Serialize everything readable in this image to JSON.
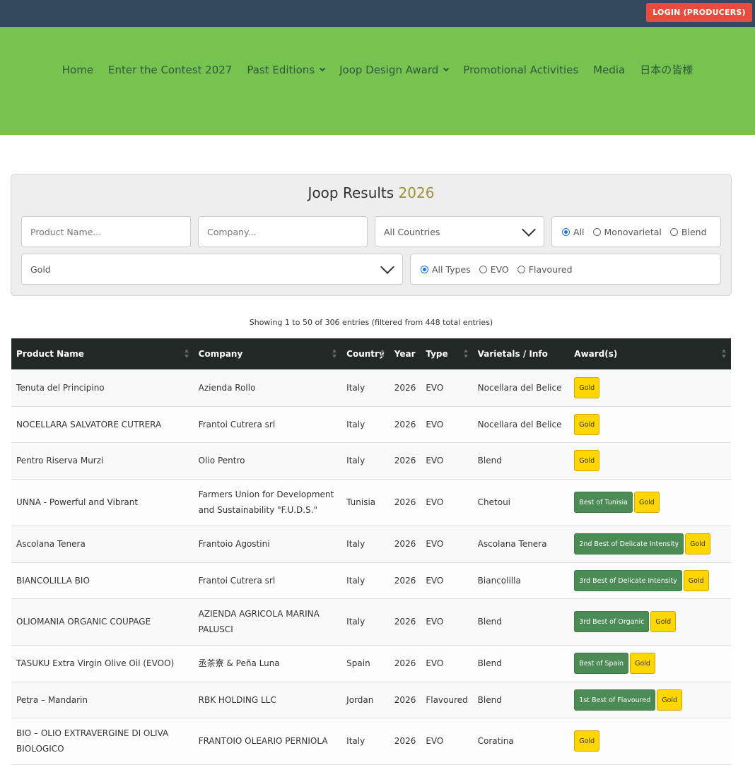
{
  "header": {
    "login_label": "LOGIN (PRODUCERS)"
  },
  "nav": {
    "items": [
      {
        "label": "Home",
        "dropdown": false
      },
      {
        "label": "Enter the Contest 2027",
        "dropdown": false
      },
      {
        "label": "Past Editions",
        "dropdown": true
      },
      {
        "label": "Joop Design Award",
        "dropdown": true
      },
      {
        "label": "Promotional Activities",
        "dropdown": false
      },
      {
        "label": "Media",
        "dropdown": false
      },
      {
        "label": "日本の皆様",
        "dropdown": false
      }
    ]
  },
  "filters": {
    "title": "Joop Results",
    "title_year": "2026",
    "product_placeholder": "Product Name...",
    "company_placeholder": "Company...",
    "country_selected": "All Countries",
    "award_selected": "Gold",
    "varietal_options": [
      "All",
      "Monovarietal",
      "Blend"
    ],
    "varietal_selected": 0,
    "type_options": [
      "All Types",
      "EVO",
      "Flavoured"
    ],
    "type_selected": 0
  },
  "table": {
    "info": "Showing 1 to 50 of 306 entries (filtered from 448 total entries)",
    "columns": [
      "Product Name",
      "Company",
      "Country",
      "Year",
      "Type",
      "Varietals / Info",
      "Award(s)"
    ],
    "rows": [
      {
        "product": "Tenuta del Principino",
        "company": "Azienda Rollo",
        "country": "Italy",
        "year": "2026",
        "type": "EVO",
        "varietal": "Nocellara del Belice",
        "awards": [
          {
            "label": "Gold",
            "kind": "gold"
          }
        ]
      },
      {
        "product": "NOCELLARA SALVATORE CUTRERA",
        "company": "Frantoi Cutrera srl",
        "country": "Italy",
        "year": "2026",
        "type": "EVO",
        "varietal": "Nocellara del Belice",
        "awards": [
          {
            "label": "Gold",
            "kind": "gold"
          }
        ]
      },
      {
        "product": "Pentro Riserva Murzi",
        "company": "Olio Pentro",
        "country": "Italy",
        "year": "2026",
        "type": "EVO",
        "varietal": "Blend",
        "awards": [
          {
            "label": "Gold",
            "kind": "gold"
          }
        ]
      },
      {
        "product": "UNNA - Powerful and Vibrant",
        "company": "Farmers Union for Development and Sustainability \"F.U.D.S.\"",
        "country": "Tunisia",
        "year": "2026",
        "type": "EVO",
        "varietal": "Chetoui",
        "awards": [
          {
            "label": "Best of Tunisia",
            "kind": "green"
          },
          {
            "label": "Gold",
            "kind": "gold"
          }
        ]
      },
      {
        "product": "Ascolana Tenera",
        "company": "Frantoio Agostini",
        "country": "Italy",
        "year": "2026",
        "type": "EVO",
        "varietal": "Ascolana Tenera",
        "awards": [
          {
            "label": "2nd Best of Delicate Intensity",
            "kind": "green"
          },
          {
            "label": "Gold",
            "kind": "gold"
          }
        ]
      },
      {
        "product": "BIANCOLILLA BIO",
        "company": "Frantoi Cutrera srl",
        "country": "Italy",
        "year": "2026",
        "type": "EVO",
        "varietal": "Biancolilla",
        "awards": [
          {
            "label": "3rd Best of Delicate Intensity",
            "kind": "green"
          },
          {
            "label": "Gold",
            "kind": "gold"
          }
        ]
      },
      {
        "product": "OLIOMANIA ORGANIC COUPAGE",
        "company": "AZIENDA AGRICOLA MARINA PALUSCI",
        "country": "Italy",
        "year": "2026",
        "type": "EVO",
        "varietal": "Blend",
        "awards": [
          {
            "label": "3rd Best of Organic",
            "kind": "green"
          },
          {
            "label": "Gold",
            "kind": "gold"
          }
        ]
      },
      {
        "product": "TASUKU Extra Virgin Olive Oil (EVOO)",
        "company": "丞茶寮 & Peña Luna",
        "country": "Spain",
        "year": "2026",
        "type": "EVO",
        "varietal": "Blend",
        "awards": [
          {
            "label": "Best of Spain",
            "kind": "green"
          },
          {
            "label": "Gold",
            "kind": "gold"
          }
        ]
      },
      {
        "product": "Petra – Mandarin",
        "company": "RBK HOLDING LLC",
        "country": "Jordan",
        "year": "2026",
        "type": "Flavoured",
        "varietal": "Blend",
        "awards": [
          {
            "label": "1st Best of Flavoured",
            "kind": "green"
          },
          {
            "label": "Gold",
            "kind": "gold"
          }
        ]
      },
      {
        "product": "BIO – OLIO EXTRAVERGINE DI OLIVA BIOLOGICO",
        "company": "FRANTOIO OLEARIO PERNIOLA",
        "country": "Italy",
        "year": "2026",
        "type": "EVO",
        "varietal": "Coratina",
        "awards": [
          {
            "label": "Gold",
            "kind": "gold"
          }
        ]
      }
    ]
  }
}
